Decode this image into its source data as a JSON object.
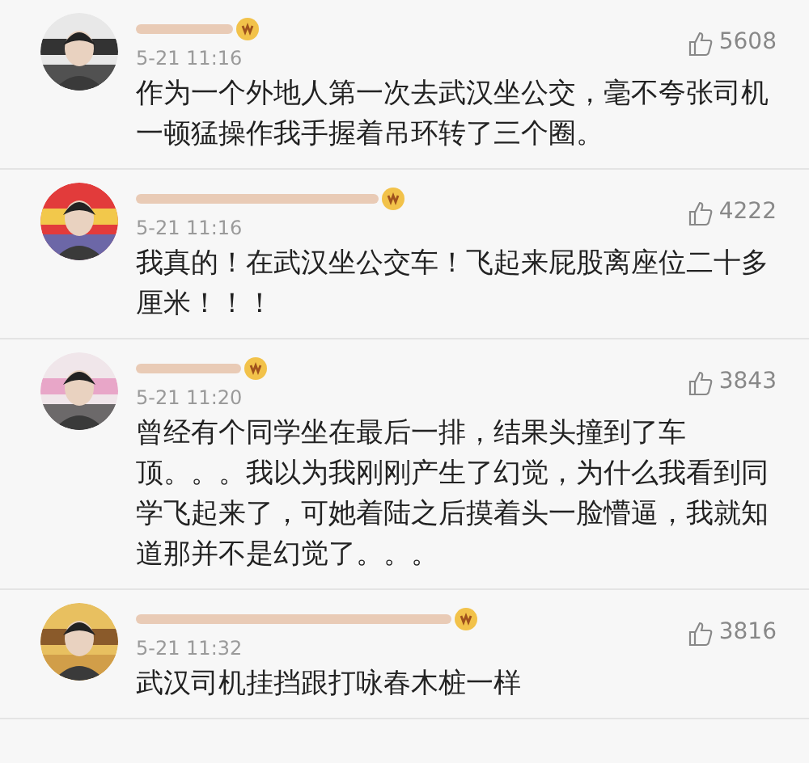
{
  "comments": [
    {
      "time": "5-21 11:16",
      "likes": "5608",
      "text": "作为一个外地人第一次去武汉坐公交，毫不夸张司机一顿猛操作我手握着吊环转了三个圈。"
    },
    {
      "time": "5-21 11:16",
      "likes": "4222",
      "text": "我真的！在武汉坐公交车！飞起来屁股离座位二十多厘米！！！"
    },
    {
      "time": "5-21 11:20",
      "likes": "3843",
      "text": "曾经有个同学坐在最后一排，结果头撞到了车顶。。。我以为我刚刚产生了幻觉，为什么我看到同学飞起来了，可她着陆之后摸着头一脸懵逼，我就知道那并不是幻觉了。。。"
    },
    {
      "time": "5-21 11:32",
      "likes": "3816",
      "text": "武汉司机挂挡跟打咏春木桩一样"
    }
  ]
}
